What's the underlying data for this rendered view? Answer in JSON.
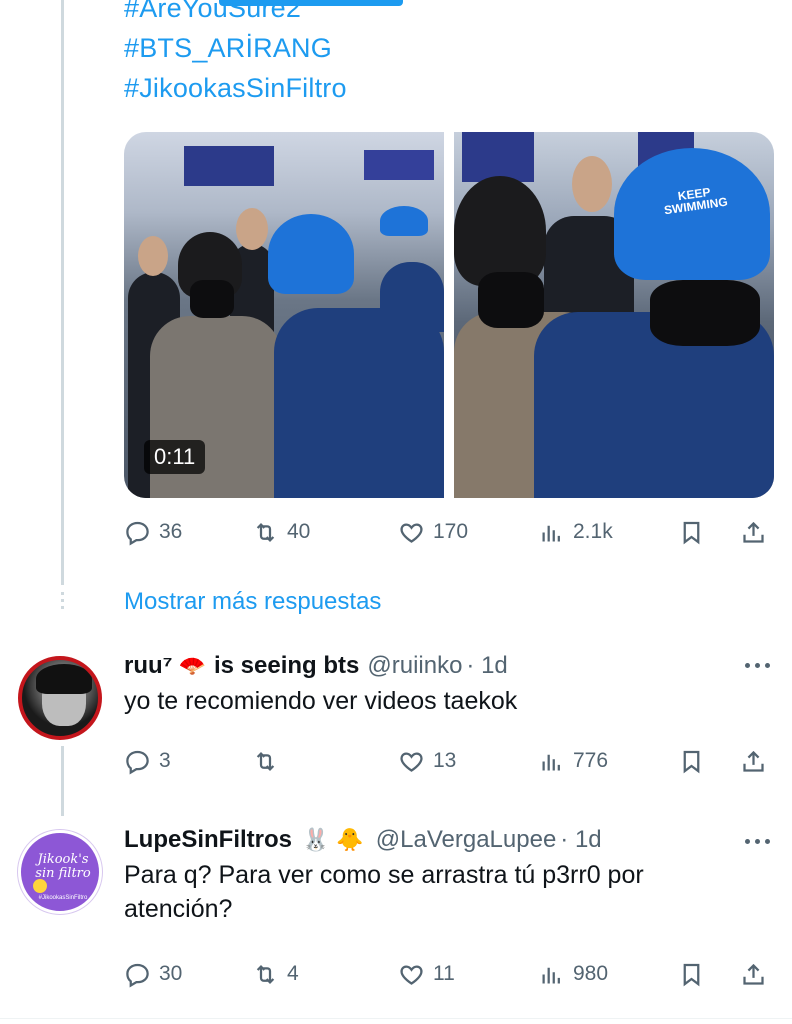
{
  "tweet": {
    "hashtags": [
      "#AreYouSure2",
      "#BTS_ARİRANG",
      "#JikookasSinFiltro"
    ],
    "media": {
      "duration": "0:11",
      "cap_text": "KEEP SWIMMING"
    },
    "stats": {
      "replies": "36",
      "reposts": "40",
      "likes": "170",
      "views": "2.1k"
    }
  },
  "show_more_label": "Mostrar más respuestas",
  "replies": [
    {
      "name": "ruu⁷",
      "name_suffix": "is seeing bts",
      "name_emoji": "🪭",
      "handle": "@ruiinko",
      "time": "· 1d",
      "text": "yo te recomiendo ver videos taekok",
      "stats": {
        "replies": "3",
        "reposts": "",
        "likes": "13",
        "views": "776"
      }
    },
    {
      "name": "LupeSinFiltros",
      "name_emoji": "🐰 🐥",
      "handle": "@LaVergaLupee",
      "time": "· 1d",
      "text": "Para q? Para ver como se arrastra tú p3rr0 por atención?",
      "avatar_text": "Jikook's sin filtro",
      "avatar_small": "#JikookasSinFiltro",
      "stats": {
        "replies": "30",
        "reposts": "4",
        "likes": "11",
        "views": "980"
      }
    }
  ],
  "colors": {
    "accent": "#1d9bf0",
    "muted": "#536471",
    "text": "#0f1419"
  }
}
